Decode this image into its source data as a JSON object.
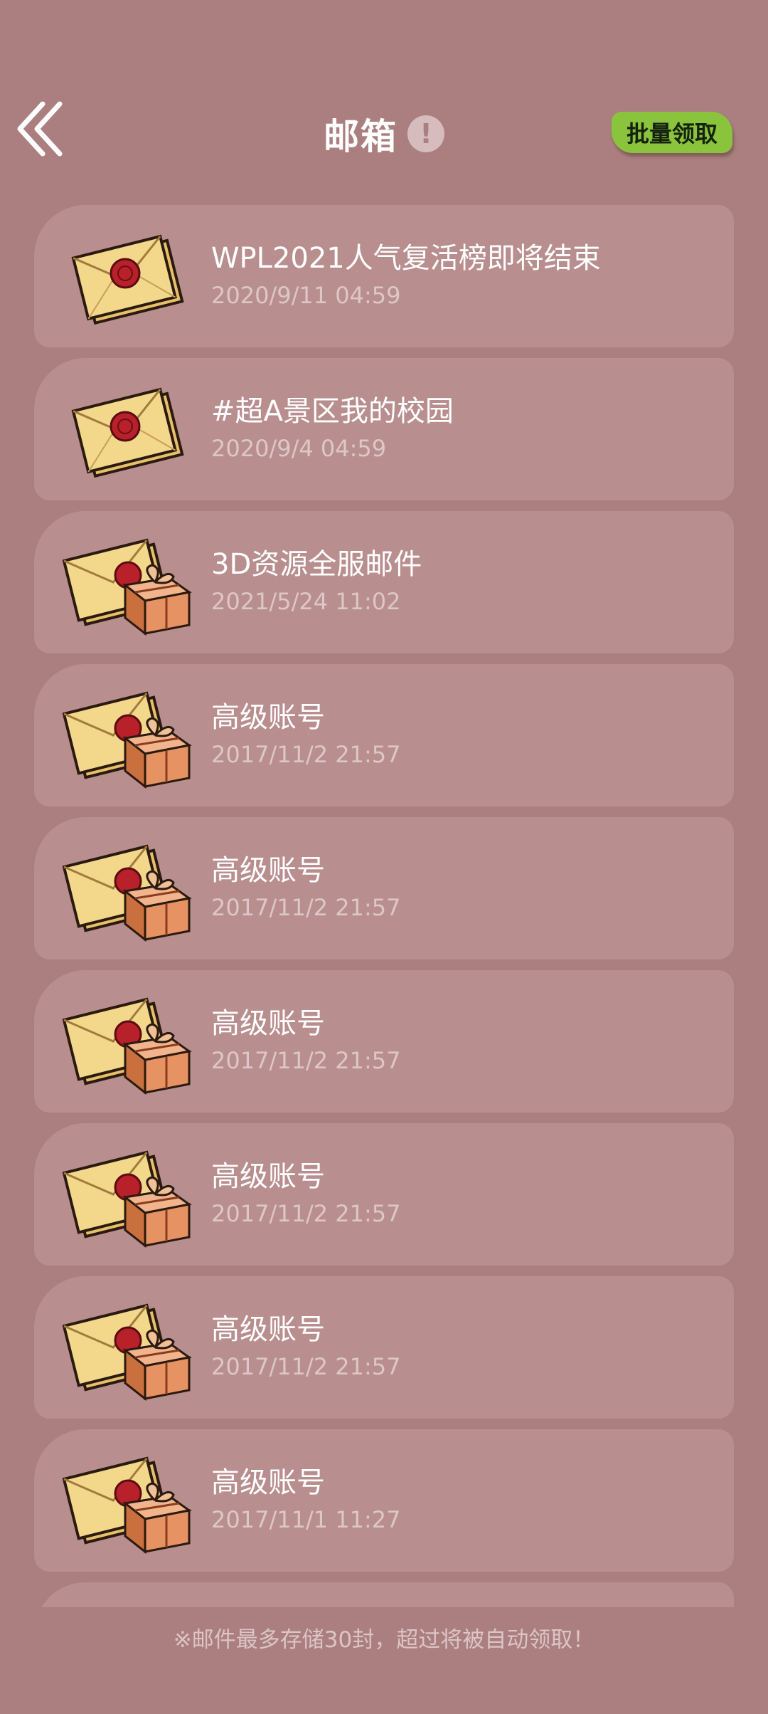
{
  "header": {
    "title": "邮箱",
    "batch_button": "批量领取"
  },
  "mails": [
    {
      "title": "WPL2021人气复活榜即将结束",
      "date": "2020/9/11  04:59",
      "icon": "envelope-icon"
    },
    {
      "title": "#超A景区我的校园",
      "date": "2020/9/4  04:59",
      "icon": "envelope-icon"
    },
    {
      "title": "3D资源全服邮件",
      "date": "2021/5/24  11:02",
      "icon": "envelope-gift-icon"
    },
    {
      "title": "高级账号",
      "date": "2017/11/2  21:57",
      "icon": "envelope-gift-icon"
    },
    {
      "title": "高级账号",
      "date": "2017/11/2  21:57",
      "icon": "envelope-gift-icon"
    },
    {
      "title": "高级账号",
      "date": "2017/11/2  21:57",
      "icon": "envelope-gift-icon"
    },
    {
      "title": "高级账号",
      "date": "2017/11/2  21:57",
      "icon": "envelope-gift-icon"
    },
    {
      "title": "高级账号",
      "date": "2017/11/2  21:57",
      "icon": "envelope-gift-icon"
    },
    {
      "title": "高级账号",
      "date": "2017/11/1  11:27",
      "icon": "envelope-gift-icon"
    }
  ],
  "footer": {
    "note": "※邮件最多存储30封，超过将被自动领取！"
  },
  "colors": {
    "background": "#ab7f7f",
    "card": "#b98e8e",
    "accent_green": "#8ac43c",
    "date_text": "#ddc7c7"
  }
}
